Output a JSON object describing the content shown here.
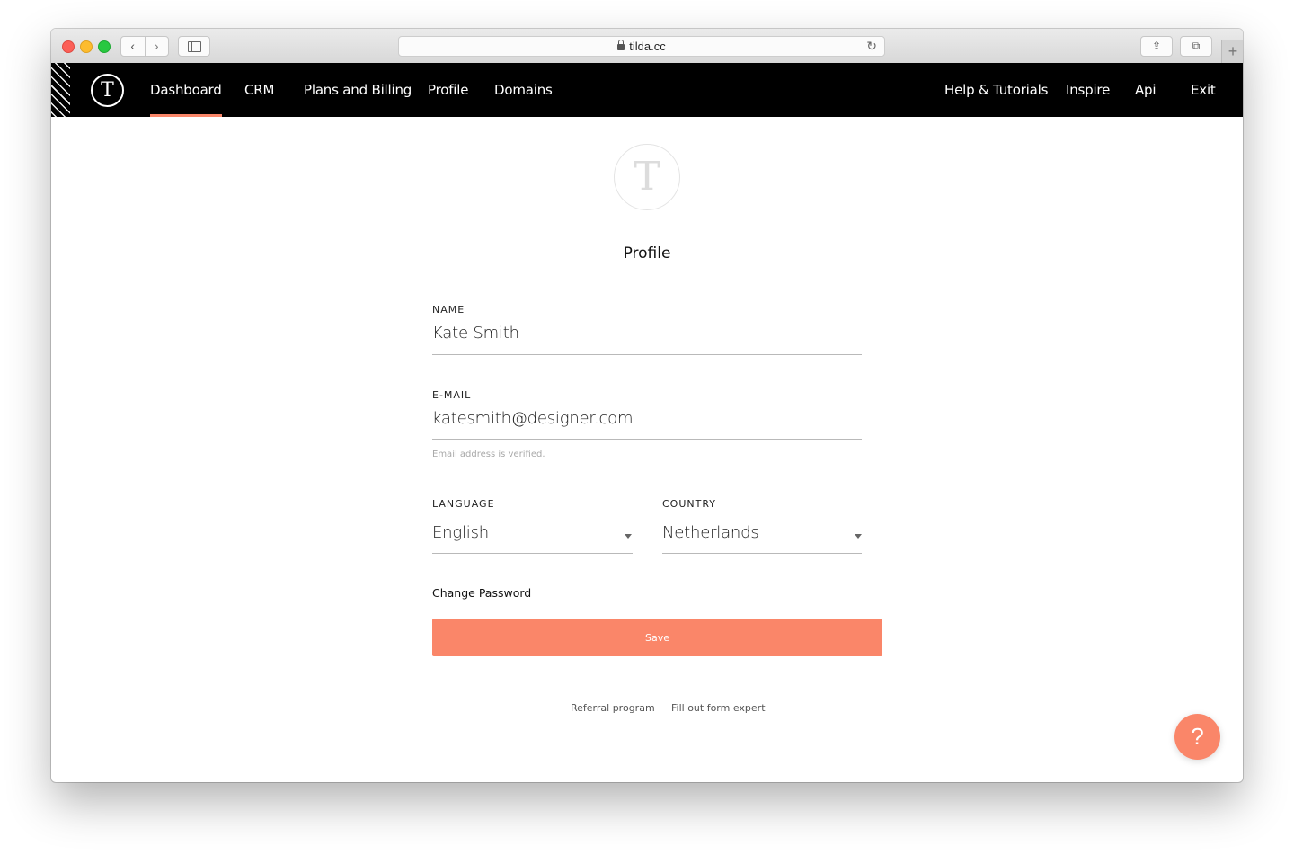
{
  "browser": {
    "url": "tilda.cc",
    "back_glyph": "‹",
    "forward_glyph": "›",
    "reload_glyph": "↻",
    "share_glyph": "⇪",
    "tabs_glyph": "⧉",
    "new_tab_glyph": "+"
  },
  "header": {
    "logo_glyph": "T",
    "nav_left": [
      {
        "label": "Dashboard",
        "active": true
      },
      {
        "label": "CRM"
      },
      {
        "label": "Plans and Billing"
      },
      {
        "label": "Profile"
      },
      {
        "label": "Domains"
      }
    ],
    "nav_right": [
      {
        "label": "Help & Tutorials"
      },
      {
        "label": "Inspire"
      },
      {
        "label": "Api"
      },
      {
        "label": "Exit"
      }
    ]
  },
  "profile": {
    "avatar_glyph": "T",
    "title": "Profile",
    "name_label": "NAME",
    "name_value": "Kate Smith",
    "email_label": "E-MAIL",
    "email_value": "katesmith@designer.com",
    "email_note": "Email address is verified.",
    "language_label": "LANGUAGE",
    "language_value": "English",
    "country_label": "COUNTRY",
    "country_value": "Netherlands",
    "change_password": "Change Password",
    "save_label": "Save"
  },
  "footer": {
    "referral": "Referral program",
    "form_expert": "Fill out form expert"
  },
  "help_fab_glyph": "?",
  "colors": {
    "accent": "#fa8669",
    "nav_bg": "#000000"
  }
}
